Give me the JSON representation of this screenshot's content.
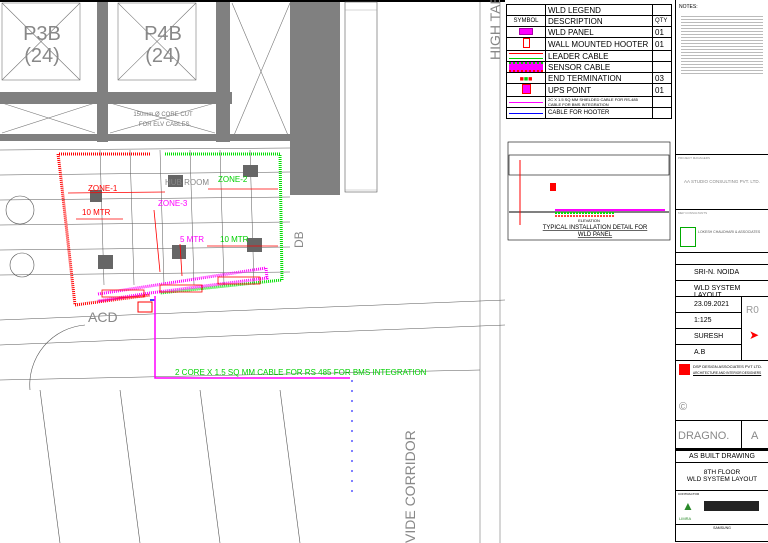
{
  "plan": {
    "shafts": [
      {
        "name": "P3B",
        "num": "(24)"
      },
      {
        "name": "P4B",
        "num": "(24)"
      }
    ],
    "core_cut_line1": "150mm Ø CORE CUT",
    "core_cut_line2": "FOR ELV CABLES.",
    "high_tab": "HIGH TAB",
    "hub_room": "HUB ROOM",
    "zone1": "ZONE-1",
    "zone2": "ZONE-2",
    "zone3": "ZONE-3",
    "zone1_len": "10 MTR",
    "zone3_len": "5 MTR",
    "zone2_len": "10 MTR",
    "db": "DB",
    "acd": "ACD",
    "cable_note": "2 CORE X 1.5 SQ MM CABLE FOR RS 485 FOR BMS INTEGRATION",
    "corridor": "VIDE CORRIDOR"
  },
  "legend": {
    "title": "WLD LEGEND",
    "headers": {
      "symbol": "SYMBOL",
      "description": "DESCRIPTION",
      "qty": "QTY"
    },
    "items": [
      {
        "desc": "WLD PANEL",
        "qty": "01"
      },
      {
        "desc": "WALL MOUNTED HOOTER",
        "qty": "01"
      },
      {
        "desc": "LEADER CABLE",
        "qty": ""
      },
      {
        "desc": "SENSOR CABLE",
        "qty": ""
      },
      {
        "desc": "END TERMINATION",
        "qty": "03"
      },
      {
        "desc": "UPS POINT",
        "qty": "01"
      },
      {
        "desc": "2C X 1.5 SQ MM SHIELDED CABLE FOR RS-485 CABLE FOR BMS INTEGRATION",
        "qty": ""
      },
      {
        "desc": "CABLE FOR HOOTER",
        "qty": ""
      }
    ]
  },
  "detail": {
    "elevation": "ELEVATION",
    "title_line1": "TYPICAL INSTALLATION DETAIL FOR",
    "title_line2": "WLD PANEL"
  },
  "title_block": {
    "notes": "NOTES:",
    "project_managers": "PROJECT MANAGERS",
    "pm_company": "AA STUDIO CONSULTING PVT. LTD.",
    "mep": "MEP CONSULTANTS",
    "mep_company": "LOKESH CHAUDHARI & ASSOCIATES",
    "project": "SRI-N. NOIDA",
    "title": "WLD SYSTEM LAYOUT",
    "date": "23.09.2021",
    "rev": "R0",
    "scale": "1:125",
    "drawn": "SURESH",
    "checked": "A.B",
    "architect": "DSP DESIGN ASSOCIATES PVT LTD.",
    "architect_sub": "ARCHITECTURE AND INTERIOR DESIGNERS",
    "dwg_no": "DRAGNO.",
    "dwg_rev": "A",
    "status": "AS BUILT DRAWING",
    "sheet_line1": "8TH FLOOR",
    "sheet_line2": "WLD SYSTEM LAYOUT",
    "contractor_label": "CONTRACTOR",
    "contractor": "LIMRA",
    "client": "SAMSUNG"
  },
  "colors": {
    "zone1": "#ff0000",
    "zone2": "#00e000",
    "zone3": "#ff00ff",
    "hooter": "#0000ff",
    "wall": "#808080"
  }
}
